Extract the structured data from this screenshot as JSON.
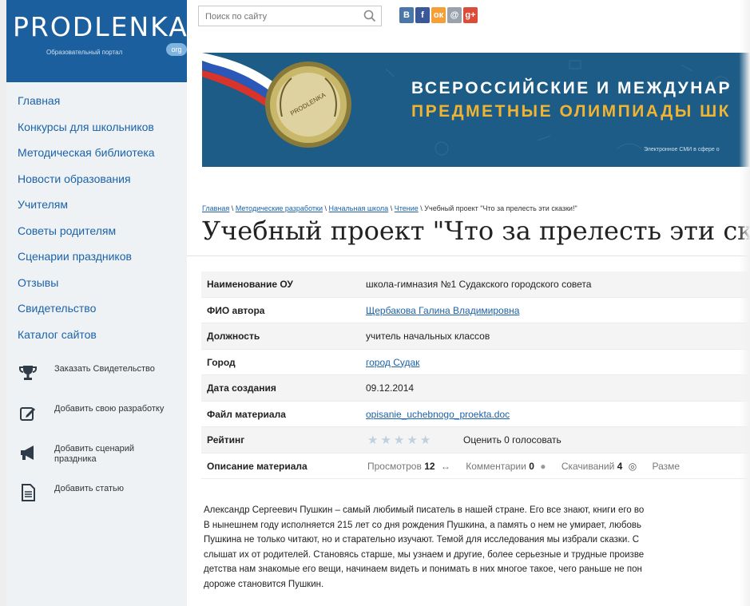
{
  "logo": {
    "name": "PRODLENKA",
    "subtitle": "Образовательный портал",
    "tld": "org"
  },
  "sidebar": {
    "nav": [
      {
        "label": "Главная"
      },
      {
        "label": "Конкурсы для школьников"
      },
      {
        "label": "Методическая библиотека"
      },
      {
        "label": "Новости образования"
      },
      {
        "label": "Учителям"
      },
      {
        "label": "Советы родителям"
      },
      {
        "label": "Сценарии праздников"
      },
      {
        "label": "Отзывы"
      },
      {
        "label": "Свидетельство"
      },
      {
        "label": "Каталог сайтов"
      }
    ],
    "actions": [
      {
        "label": "Заказать Свидетельство",
        "icon": "trophy-icon"
      },
      {
        "label": "Добавить свою разработку",
        "icon": "edit-icon"
      },
      {
        "label": "Добавить сценарий праздника",
        "icon": "megaphone-icon"
      },
      {
        "label": "Добавить статью",
        "icon": "document-icon"
      }
    ]
  },
  "search": {
    "placeholder": "Поиск по сайту"
  },
  "social": [
    {
      "label": "В",
      "color": "#4a76a8",
      "icon": "vk-icon"
    },
    {
      "label": "f",
      "color": "#3b5998",
      "icon": "facebook-icon"
    },
    {
      "label": "ок",
      "color": "#f4a036",
      "icon": "odnoklassniki-icon"
    },
    {
      "label": "@",
      "color": "#9aa3ab",
      "icon": "mailru-icon"
    },
    {
      "label": "g+",
      "color": "#dd4b39",
      "icon": "googleplus-icon"
    }
  ],
  "banner": {
    "line1": "ВСЕРОССИЙСКИЕ И МЕЖДУНАР",
    "line2": "ПРЕДМЕТНЫЕ ОЛИМПИАДЫ ШК",
    "small": "Электронное СМИ в сфере о",
    "medal_text": "PRODLENKA"
  },
  "breadcrumb": {
    "items": [
      "Главная",
      "Методические разработки",
      "Начальная школа",
      "Чтение"
    ],
    "separator": "\\",
    "current": "Учебный проект \"Что за прелесть эти сказки!\""
  },
  "title": "Учебный проект \"Что за прелесть эти ск",
  "info": {
    "org_label": "Наименование ОУ",
    "org_value": "школа-гимназия №1 Судакского городского совета",
    "author_label": "ФИО автора",
    "author_value": "Щербакова Галина Владимировна",
    "position_label": "Должность",
    "position_value": "учитель начальных классов",
    "city_label": "Город",
    "city_value": "город Судак",
    "date_label": "Дата создания",
    "date_value": "09.12.2014",
    "file_label": "Файл материала",
    "file_value": "opisanie_uchebnogo_proekta.doc",
    "rating_label": "Рейтинг",
    "rating_stars": 0,
    "rating_action": "Оценить",
    "rating_votes": "0 голосовать",
    "desc_label": "Описание материала",
    "views_label": "Просмотров",
    "views_value": "12",
    "comments_label": "Комментарии",
    "comments_value": "0",
    "downloads_label": "Скачиваний",
    "downloads_value": "4",
    "size_label": "Разме"
  },
  "body": [
    "Александр Сергеевич Пушкин – самый любимый писатель в нашей стране. Его все знают, книги его во",
    "В нынешнем году исполняется 215 лет со дня рождения Пушкина, а память о нем не умирает, любовь",
    "Пушкина не только читают, но и старательно изучают. Темой для исследования мы избрали сказки. С",
    "слышат их от родителей. Становясь старше, мы узнаем и другие, более серьезные и трудные произве",
    "детства нам знакомые его вещи, начинаем видеть и понимать в них многое такое, чего раньше не пон",
    "дороже становится Пушкин."
  ]
}
